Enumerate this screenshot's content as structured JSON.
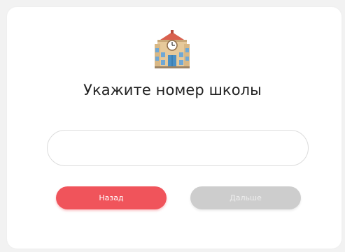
{
  "header": {
    "icon": "school-building-icon",
    "title": "Укажите номер школы"
  },
  "form": {
    "school_number": {
      "value": "",
      "placeholder": ""
    }
  },
  "buttons": {
    "back_label": "Назад",
    "next_label": "Дальше"
  },
  "colors": {
    "background": "#f2f2f2",
    "card": "#ffffff",
    "back_button": "#f0545b",
    "next_button_disabled": "#cdcdcd",
    "title_text": "#222222"
  }
}
